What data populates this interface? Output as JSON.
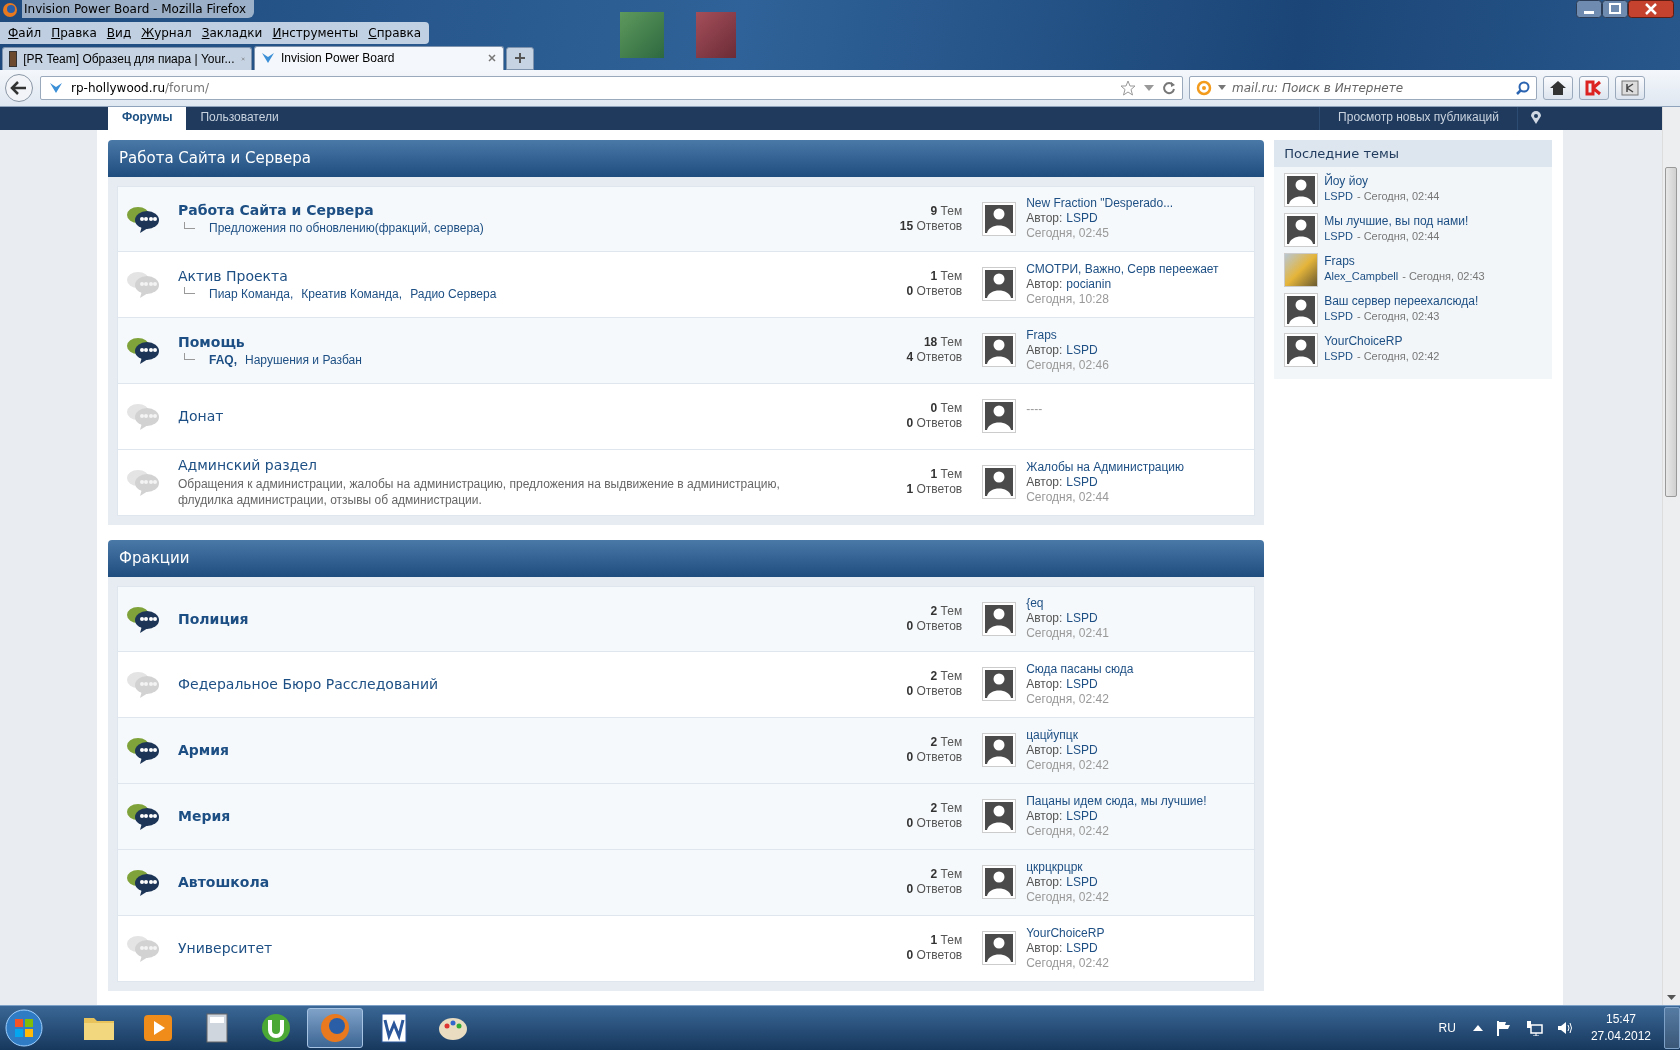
{
  "window": {
    "title": "Invision Power Board - Mozilla Firefox"
  },
  "menu": [
    "Файл",
    "Правка",
    "Вид",
    "Журнал",
    "Закладки",
    "Инструменты",
    "Справка"
  ],
  "tabs": [
    {
      "label": "[PR Team] Образец для пиара | Your...",
      "selected": false,
      "kind": "photo"
    },
    {
      "label": "Invision Power Board",
      "selected": true,
      "kind": "site"
    }
  ],
  "address": {
    "host": "rp-hollywood.ru",
    "path": "/forum/"
  },
  "search": {
    "placeholder": "mail.ru: Поиск в Интернете"
  },
  "forum_nav": {
    "tabs": [
      {
        "label": "Форумы",
        "selected": true
      },
      {
        "label": "Пользователи",
        "selected": false
      }
    ],
    "new_posts": "Просмотр новых публикаций"
  },
  "categories": [
    {
      "title": "Работа Сайта и Сервера",
      "forums": [
        {
          "name": "Работа Сайта и Сервера",
          "unread": true,
          "subforums": [
            {
              "label": "Предложения по обновлению(фракций, сервера)",
              "unread": false
            }
          ],
          "topics": "**9** Тем",
          "replies": "**15** Ответов",
          "last_post": {
            "title": "New Fraction \"Desperado...",
            "author_label": "Автор:",
            "author": "LSPD",
            "date": "Сегодня, 02:45"
          }
        },
        {
          "name": "Актив Проекта",
          "unread": false,
          "subforums": [
            {
              "label": "Пиар Команда,",
              "unread": false
            },
            {
              "label": "Креатив Команда,",
              "unread": false
            },
            {
              "label": "Радио Сервера",
              "unread": false
            }
          ],
          "topics": "**1** Тем",
          "replies": "**0** Ответов",
          "last_post": {
            "title": "СМОТРИ, Важно, Серв переежает",
            "author_label": "Автор:",
            "author": "pocianin",
            "date": "Сегодня, 10:28"
          }
        },
        {
          "name": "Помощь",
          "unread": true,
          "subforums": [
            {
              "label": "FAQ,",
              "unread": true
            },
            {
              "label": "Нарушения и Разбан",
              "unread": false
            }
          ],
          "topics": "**18** Тем",
          "replies": "**4** Ответов",
          "last_post": {
            "title": "Fraps",
            "author_label": "Автор:",
            "author": "LSPD",
            "date": "Сегодня, 02:46"
          }
        },
        {
          "name": "Донат",
          "unread": false,
          "topics": "**0** Тем",
          "replies": "**0** Ответов",
          "last_post": {
            "title": "----"
          }
        },
        {
          "name": "Админский раздел",
          "unread": false,
          "description": "Обращения к администрации, жалобы на администрацию, предложения на выдвижение в администрацию, флудилка администрации, отзывы об администрации.",
          "topics": "**1** Тем",
          "replies": "**1** Ответов",
          "last_post": {
            "title": "Жалобы на Администрацию",
            "author_label": "Автор:",
            "author": "LSPD",
            "date": "Сегодня, 02:44"
          }
        }
      ]
    },
    {
      "title": "Фракции",
      "forums": [
        {
          "name": "Полиция",
          "unread": true,
          "topics": "**2** Тем",
          "replies": "**0** Ответов",
          "last_post": {
            "title": "{eq",
            "author_label": "Автор:",
            "author": "LSPD",
            "date": "Сегодня, 02:41"
          }
        },
        {
          "name": "Федеральное Бюро Расследований",
          "unread": false,
          "topics": "**2** Тем",
          "replies": "**0** Ответов",
          "last_post": {
            "title": "Сюда пасаны сюда",
            "author_label": "Автор:",
            "author": "LSPD",
            "date": "Сегодня, 02:42"
          }
        },
        {
          "name": "Армия",
          "unread": true,
          "topics": "**2** Тем",
          "replies": "**0** Ответов",
          "last_post": {
            "title": "цацйупцк",
            "author_label": "Автор:",
            "author": "LSPD",
            "date": "Сегодня, 02:42"
          }
        },
        {
          "name": "Мерия",
          "unread": true,
          "topics": "**2** Тем",
          "replies": "**0** Ответов",
          "last_post": {
            "title": "Пацаны идем сюда, мы лучшие!",
            "author_label": "Автор:",
            "author": "LSPD",
            "date": "Сегодня, 02:42"
          }
        },
        {
          "name": "Автошкола",
          "unread": true,
          "topics": "**2** Тем",
          "replies": "**0** Ответов",
          "last_post": {
            "title": "цкрцкрцрк",
            "author_label": "Автор:",
            "author": "LSPD",
            "date": "Сегодня, 02:42"
          }
        },
        {
          "name": "Университет",
          "unread": false,
          "topics": "**1** Тем",
          "replies": "**0** Ответов",
          "last_post": {
            "title": "YourChoiceRP",
            "author_label": "Автор:",
            "author": "LSPD",
            "date": "Сегодня, 02:42"
          }
        }
      ]
    }
  ],
  "sidebar": {
    "title": "Последние темы",
    "topics": [
      {
        "title": "Йоу йоу",
        "author": "LSPD",
        "date": "- Сегодня, 02:44",
        "kind": "default"
      },
      {
        "title": "Мы лучшие, вы под нами!",
        "author": "LSPD",
        "date": "- Сегодня, 02:44",
        "kind": "default"
      },
      {
        "title": "Fraps",
        "author": "Alex_Campbell",
        "date": "- Сегодня, 02:43",
        "kind": "photo"
      },
      {
        "title": "Ваш сервер переехалсюда!",
        "author": "LSPD",
        "date": "- Сегодня, 02:43",
        "kind": "default"
      },
      {
        "title": "YourChoiceRP",
        "author": "LSPD",
        "date": "- Сегодня, 02:42",
        "kind": "default"
      }
    ]
  },
  "taskbar": {
    "apps": [
      {
        "kind": "folder",
        "selected": false
      },
      {
        "kind": "media",
        "selected": false
      },
      {
        "kind": "calculator",
        "selected": false
      },
      {
        "kind": "torrent",
        "selected": false
      },
      {
        "kind": "browser",
        "selected": true
      },
      {
        "kind": "word",
        "selected": false
      },
      {
        "kind": "paint",
        "selected": false
      }
    ],
    "language": "RU",
    "time": "15:47",
    "date": "27.04.2012"
  }
}
